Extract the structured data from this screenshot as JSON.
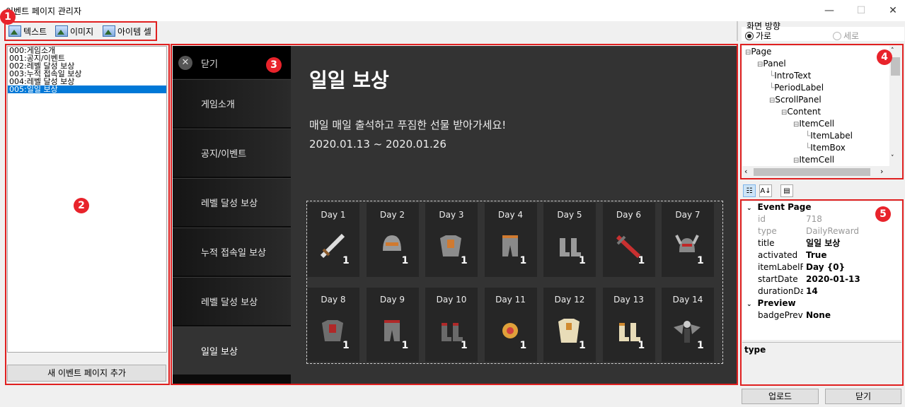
{
  "window": {
    "title": "이벤트 페이지 관리자",
    "minimize": "—",
    "maximize": "☐",
    "close": "✕"
  },
  "toolbar": {
    "text_label": "텍스트",
    "image_label": "이미지",
    "item_cell_label": "아이템 셀"
  },
  "badges": [
    "1",
    "2",
    "3",
    "4",
    "5"
  ],
  "page_list": {
    "items": [
      "000:게임소개",
      "001:공지/이벤트",
      "002:레벨 달성 보상",
      "003:누적 접속일 보상",
      "004:레벨 달성 보상",
      "005:일일 보상"
    ],
    "selected_index": 5,
    "add_button": "새 이벤트 페이지 추가"
  },
  "preview": {
    "close_label": "닫기",
    "close_icon": "✕",
    "nav": [
      "게임소개",
      "공지/이벤트",
      "레벨 달성 보상",
      "누적 접속일 보상",
      "레벨 달성 보상",
      "일일 보상"
    ],
    "active_nav": 5,
    "title": "일일 보상",
    "intro": "매일 매일 출석하고 푸짐한 선물 받아가세요!",
    "period": "2020.01.13 ~ 2020.01.26",
    "cells": [
      {
        "day": "Day 1",
        "count": "1",
        "icon": "sword-icon"
      },
      {
        "day": "Day 2",
        "count": "1",
        "icon": "helmet-icon"
      },
      {
        "day": "Day 3",
        "count": "1",
        "icon": "armor-icon"
      },
      {
        "day": "Day 4",
        "count": "1",
        "icon": "leggings-icon"
      },
      {
        "day": "Day 5",
        "count": "1",
        "icon": "boots-icon"
      },
      {
        "day": "Day 6",
        "count": "1",
        "icon": "red-sword-icon"
      },
      {
        "day": "Day 7",
        "count": "1",
        "icon": "horned-helmet-icon"
      },
      {
        "day": "Day 8",
        "count": "1",
        "icon": "red-armor-icon"
      },
      {
        "day": "Day 9",
        "count": "1",
        "icon": "red-leggings-icon"
      },
      {
        "day": "Day 10",
        "count": "1",
        "icon": "red-boots-icon"
      },
      {
        "day": "Day 11",
        "count": "1",
        "icon": "gold-helmet-icon"
      },
      {
        "day": "Day 12",
        "count": "1",
        "icon": "gold-armor-icon"
      },
      {
        "day": "Day 13",
        "count": "1",
        "icon": "gold-boots-icon"
      },
      {
        "day": "Day 14",
        "count": "1",
        "icon": "angel-figure-icon"
      }
    ]
  },
  "orientation": {
    "label": "화면 방향",
    "landscape": "가로",
    "portrait": "세로",
    "selected": "가로"
  },
  "tree": [
    {
      "label": "Page",
      "depth": 0,
      "toggle": "⊟"
    },
    {
      "label": "Panel",
      "depth": 1,
      "toggle": "⊟"
    },
    {
      "label": "IntroText",
      "depth": 2,
      "toggle": ""
    },
    {
      "label": "PeriodLabel",
      "depth": 2,
      "toggle": ""
    },
    {
      "label": "ScrollPanel",
      "depth": 2,
      "toggle": "⊟"
    },
    {
      "label": "Content",
      "depth": 3,
      "toggle": "⊟"
    },
    {
      "label": "ItemCell",
      "depth": 4,
      "toggle": "⊟"
    },
    {
      "label": "ItemLabel",
      "depth": 5,
      "toggle": ""
    },
    {
      "label": "ItemBox",
      "depth": 5,
      "toggle": ""
    },
    {
      "label": "ItemCell",
      "depth": 4,
      "toggle": "⊟"
    }
  ],
  "properties": {
    "categories": [
      {
        "name": "Event Page",
        "rows": [
          {
            "key": "id",
            "value": "718",
            "readonly": true
          },
          {
            "key": "type",
            "value": "DailyReward",
            "readonly": true
          },
          {
            "key": "title",
            "value": "일일 보상",
            "readonly": false
          },
          {
            "key": "activated",
            "value": "True",
            "readonly": false
          },
          {
            "key": "itemLabelForn",
            "value": "Day {0}",
            "readonly": false
          },
          {
            "key": "startDate",
            "value": "2020-01-13",
            "readonly": false
          },
          {
            "key": "durationDay",
            "value": "14",
            "readonly": false
          }
        ]
      },
      {
        "name": "Preview",
        "rows": [
          {
            "key": "badgePreview",
            "value": "None",
            "readonly": false
          }
        ]
      }
    ],
    "description": "type"
  },
  "footer": {
    "upload": "업로드",
    "close": "닫기"
  }
}
